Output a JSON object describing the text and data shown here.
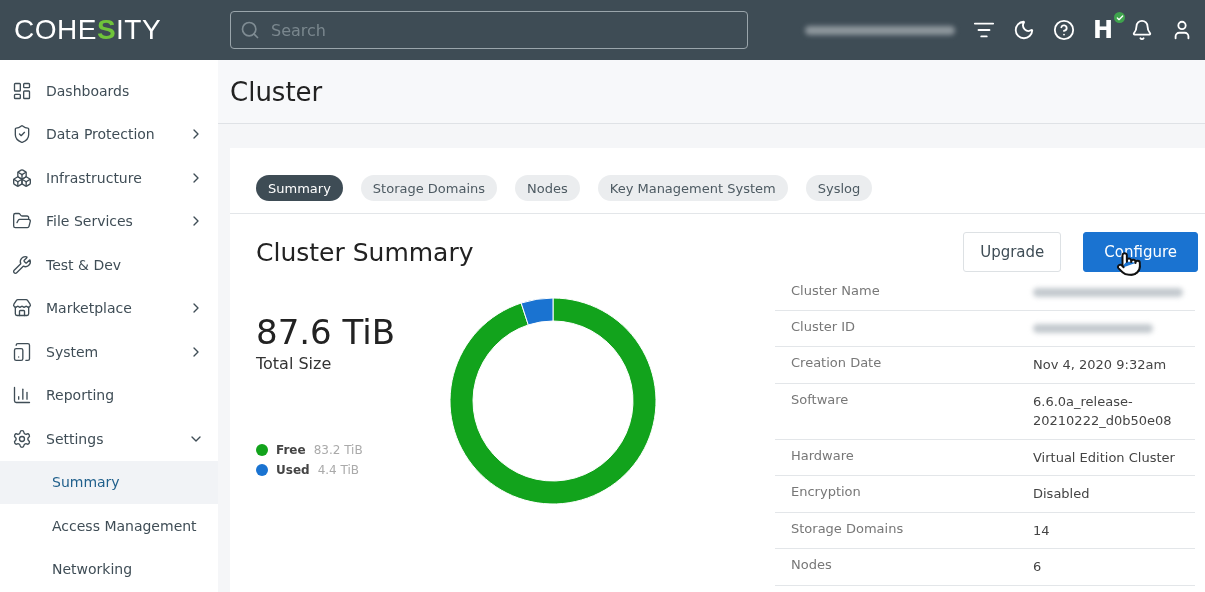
{
  "header": {
    "logo": {
      "parts": [
        {
          "text": "COHE",
          "accent": false
        },
        {
          "text": "S",
          "accent": true
        },
        {
          "text": "ITY",
          "accent": false
        }
      ]
    },
    "search": {
      "placeholder": "Search"
    },
    "helios_label": "H",
    "health_ok": true
  },
  "sidebar": {
    "items": [
      {
        "label": "Dashboards",
        "selected": false
      },
      {
        "label": "Data Protection",
        "expanded": false,
        "selected": false
      },
      {
        "label": "Infrastructure",
        "expanded": false,
        "selected": false
      },
      {
        "label": "File Services",
        "expanded": false,
        "selected": false
      },
      {
        "label": "Test & Dev",
        "selected": false
      },
      {
        "label": "Marketplace",
        "expanded": false,
        "selected": false
      },
      {
        "label": "System",
        "expanded": false,
        "selected": false
      },
      {
        "label": "Reporting",
        "selected": false
      },
      {
        "label": "Settings",
        "expanded": true,
        "selected": false,
        "children": [
          {
            "label": "Summary",
            "selected": true
          },
          {
            "label": "Access Management",
            "selected": false
          },
          {
            "label": "Networking",
            "selected": false
          }
        ]
      }
    ]
  },
  "page_title": "Cluster",
  "tabs": [
    {
      "label": "Summary",
      "selected": true
    },
    {
      "label": "Storage Domains",
      "selected": false
    },
    {
      "label": "Nodes",
      "selected": false
    },
    {
      "label": "Key Management System",
      "selected": false
    },
    {
      "label": "Syslog",
      "selected": false
    }
  ],
  "summary": {
    "title": "Cluster Summary",
    "buttons": [
      {
        "label": "Upgrade",
        "kind": "secondary"
      },
      {
        "label": "Configure",
        "kind": "primary"
      }
    ],
    "total": {
      "value": "87.6 TiB",
      "label": "Total Size"
    },
    "legend": [
      {
        "value": "83.2 TiB",
        "color": "#12a31c"
      },
      {
        "value": "4.4 TiB",
        "color": "#1a73d1"
      }
    ],
    "chart_data": {
      "type": "donut",
      "categories": [
        "Free",
        "Used"
      ],
      "values": [
        95,
        5
      ]
    },
    "details": [
      {
        "label": "Cluster Name"
      },
      {
        "label": "Cluster ID"
      },
      {
        "label": "Creation Date",
        "value": "Nov 4, 2020 9:32am"
      },
      {
        "label": "Software",
        "value": "6.6.0a_release-\n20210222_d0b50e08"
      },
      {
        "label": "Hardware",
        "value": "Virtual Edition Cluster"
      },
      {
        "label": "Encryption",
        "value": "Disabled"
      },
      {
        "label": "Storage Domains",
        "value": "14"
      },
      {
        "label": "Nodes",
        "value": "6"
      }
    ]
  }
}
